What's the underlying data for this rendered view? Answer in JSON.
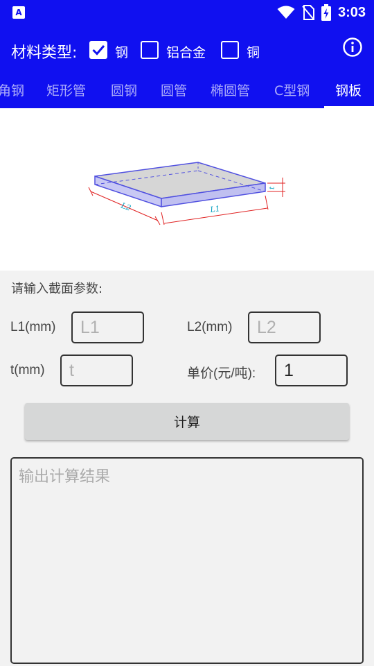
{
  "status_bar": {
    "time": "3:03",
    "app_badge": "A"
  },
  "material": {
    "label": "材料类型:",
    "options": [
      {
        "label": "钢",
        "checked": true
      },
      {
        "label": "铝合金",
        "checked": false
      },
      {
        "label": "铜",
        "checked": false
      }
    ]
  },
  "tabs": [
    {
      "label": "角钢"
    },
    {
      "label": "矩形管"
    },
    {
      "label": "圆钢"
    },
    {
      "label": "圆管"
    },
    {
      "label": "椭圆管"
    },
    {
      "label": "C型钢"
    },
    {
      "label": "钢板",
      "active": true
    }
  ],
  "diagram": {
    "label_l1": "L1",
    "label_l2": "L2",
    "label_t": "t"
  },
  "form": {
    "title": "请输入截面参数:",
    "l1": {
      "label": "L1(mm)",
      "placeholder": "L1",
      "value": ""
    },
    "l2": {
      "label": "L2(mm)",
      "placeholder": "L2",
      "value": ""
    },
    "t": {
      "label": "t(mm)",
      "placeholder": "t",
      "value": ""
    },
    "price": {
      "label": "单价(元/吨):",
      "value": "1"
    },
    "calc_label": "计算",
    "output_placeholder": "输出计算结果"
  },
  "colors": {
    "primary": "#1010f0",
    "background": "#f2f2f2"
  }
}
